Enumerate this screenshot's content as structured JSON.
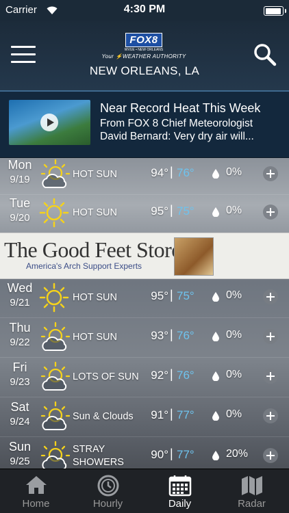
{
  "status_bar": {
    "carrier": "Carrier",
    "time": "4:30 PM",
    "battery_level": 1.0
  },
  "header": {
    "logo_text": "FOX8",
    "logo_subtext": "WVUE • NEW ORLEANS",
    "logo_tagline_your": "Your",
    "logo_tagline_rest": "WEATHER AUTHORITY",
    "location": "NEW ORLEANS, LA"
  },
  "news": {
    "title": "Near Record Heat This Week",
    "body_line1": "From FOX 8 Chief Meteorologist",
    "body_line2": "David Bernard: Very dry air will..."
  },
  "forecast": [
    {
      "day": "Mon",
      "date": "9/19",
      "icon": "sun-cloud-icon",
      "condition": "HOT SUN",
      "high": "94°",
      "low": "76°",
      "precip": "0%"
    },
    {
      "day": "Tue",
      "date": "9/20",
      "icon": "sun-icon",
      "condition": "HOT SUN",
      "high": "95°",
      "low": "75°",
      "precip": "0%"
    },
    {
      "day": "Wed",
      "date": "9/21",
      "icon": "sun-icon",
      "condition": "HOT SUN",
      "high": "95°",
      "low": "75°",
      "precip": "0%"
    },
    {
      "day": "Thu",
      "date": "9/22",
      "icon": "sun-cloud-icon",
      "condition": "HOT SUN",
      "high": "93°",
      "low": "76°",
      "precip": "0%"
    },
    {
      "day": "Fri",
      "date": "9/23",
      "icon": "sun-cloud-icon",
      "condition": "LOTS OF SUN",
      "high": "92°",
      "low": "76°",
      "precip": "0%"
    },
    {
      "day": "Sat",
      "date": "9/24",
      "icon": "sun-cloud-icon",
      "condition": "Sun & Clouds",
      "high": "91°",
      "low": "77°",
      "precip": "0%"
    },
    {
      "day": "Sun",
      "date": "9/25",
      "icon": "sun-cloud-icon",
      "condition": "STRAY SHOWERS",
      "high": "90°",
      "low": "77°",
      "precip": "20%"
    }
  ],
  "ad": {
    "name": "The Good Feet Store",
    "tagline": "America's Arch Support Experts"
  },
  "tabs": [
    {
      "label": "Home",
      "icon": "home-icon",
      "active": false
    },
    {
      "label": "Hourly",
      "icon": "clock-icon",
      "active": false
    },
    {
      "label": "Daily",
      "icon": "calendar-icon",
      "active": true
    },
    {
      "label": "Radar",
      "icon": "map-icon",
      "active": false
    }
  ],
  "colors": {
    "low_temp": "#6ec3ee",
    "header_bg": "#1c2b3a",
    "accent_red": "#e8262b",
    "accent_gold": "#f3b321"
  }
}
